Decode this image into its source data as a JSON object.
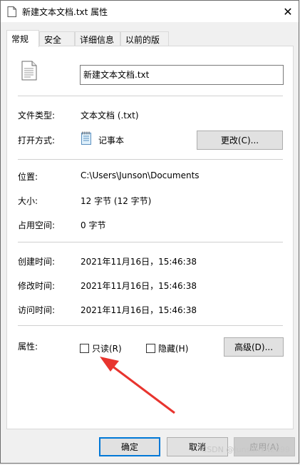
{
  "window": {
    "title": "新建文本文档.txt 属性",
    "close_glyph": "✕"
  },
  "tabs": [
    {
      "label": "常规",
      "active": true
    },
    {
      "label": "安全"
    },
    {
      "label": "详细信息"
    },
    {
      "label": "以前的版本"
    }
  ],
  "general": {
    "filename": "新建文本文档.txt",
    "file_type_label": "文件类型:",
    "file_type_value": "文本文档 (.txt)",
    "open_with_label": "打开方式:",
    "open_with_value": "记事本",
    "change_button": "更改(C)...",
    "location_label": "位置:",
    "location_value": "C:\\Users\\Junson\\Documents",
    "size_label": "大小:",
    "size_value": "12 字节 (12 字节)",
    "disk_size_label": "占用空间:",
    "disk_size_value": "0 字节",
    "created_label": "创建时间:",
    "created_value": "2021年11月16日，15:46:38",
    "modified_label": "修改时间:",
    "modified_value": "2021年11月16日，15:46:38",
    "accessed_label": "访问时间:",
    "accessed_value": "2021年11月16日，15:46:38",
    "attributes_label": "属性:",
    "readonly_label": "只读(R)",
    "hidden_label": "隐藏(H)",
    "advanced_button": "高级(D)..."
  },
  "footer": {
    "ok": "确定",
    "cancel": "取消",
    "apply": "应用(A)",
    "watermark": "CSDN @Junson142099"
  },
  "colors": {
    "accent": "#0078d7",
    "annotation_arrow": "#e8342e"
  }
}
